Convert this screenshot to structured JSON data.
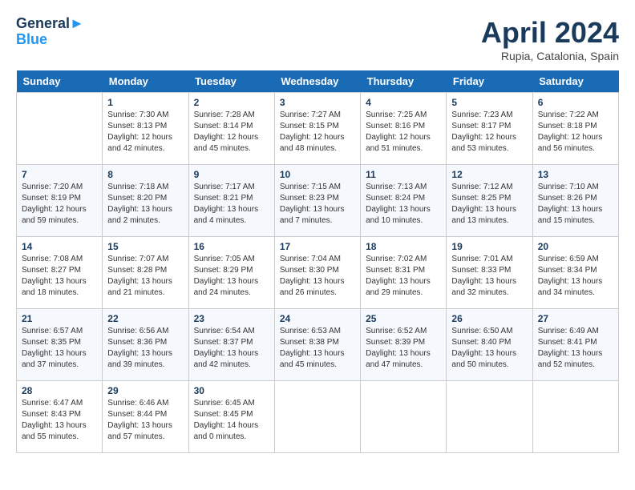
{
  "header": {
    "logo_line1": "General",
    "logo_line2": "Blue",
    "month_title": "April 2024",
    "location": "Rupia, Catalonia, Spain"
  },
  "days_of_week": [
    "Sunday",
    "Monday",
    "Tuesday",
    "Wednesday",
    "Thursday",
    "Friday",
    "Saturday"
  ],
  "weeks": [
    [
      {
        "day": "",
        "sunrise": "",
        "sunset": "",
        "daylight": ""
      },
      {
        "day": "1",
        "sunrise": "Sunrise: 7:30 AM",
        "sunset": "Sunset: 8:13 PM",
        "daylight": "Daylight: 12 hours and 42 minutes."
      },
      {
        "day": "2",
        "sunrise": "Sunrise: 7:28 AM",
        "sunset": "Sunset: 8:14 PM",
        "daylight": "Daylight: 12 hours and 45 minutes."
      },
      {
        "day": "3",
        "sunrise": "Sunrise: 7:27 AM",
        "sunset": "Sunset: 8:15 PM",
        "daylight": "Daylight: 12 hours and 48 minutes."
      },
      {
        "day": "4",
        "sunrise": "Sunrise: 7:25 AM",
        "sunset": "Sunset: 8:16 PM",
        "daylight": "Daylight: 12 hours and 51 minutes."
      },
      {
        "day": "5",
        "sunrise": "Sunrise: 7:23 AM",
        "sunset": "Sunset: 8:17 PM",
        "daylight": "Daylight: 12 hours and 53 minutes."
      },
      {
        "day": "6",
        "sunrise": "Sunrise: 7:22 AM",
        "sunset": "Sunset: 8:18 PM",
        "daylight": "Daylight: 12 hours and 56 minutes."
      }
    ],
    [
      {
        "day": "7",
        "sunrise": "Sunrise: 7:20 AM",
        "sunset": "Sunset: 8:19 PM",
        "daylight": "Daylight: 12 hours and 59 minutes."
      },
      {
        "day": "8",
        "sunrise": "Sunrise: 7:18 AM",
        "sunset": "Sunset: 8:20 PM",
        "daylight": "Daylight: 13 hours and 2 minutes."
      },
      {
        "day": "9",
        "sunrise": "Sunrise: 7:17 AM",
        "sunset": "Sunset: 8:21 PM",
        "daylight": "Daylight: 13 hours and 4 minutes."
      },
      {
        "day": "10",
        "sunrise": "Sunrise: 7:15 AM",
        "sunset": "Sunset: 8:23 PM",
        "daylight": "Daylight: 13 hours and 7 minutes."
      },
      {
        "day": "11",
        "sunrise": "Sunrise: 7:13 AM",
        "sunset": "Sunset: 8:24 PM",
        "daylight": "Daylight: 13 hours and 10 minutes."
      },
      {
        "day": "12",
        "sunrise": "Sunrise: 7:12 AM",
        "sunset": "Sunset: 8:25 PM",
        "daylight": "Daylight: 13 hours and 13 minutes."
      },
      {
        "day": "13",
        "sunrise": "Sunrise: 7:10 AM",
        "sunset": "Sunset: 8:26 PM",
        "daylight": "Daylight: 13 hours and 15 minutes."
      }
    ],
    [
      {
        "day": "14",
        "sunrise": "Sunrise: 7:08 AM",
        "sunset": "Sunset: 8:27 PM",
        "daylight": "Daylight: 13 hours and 18 minutes."
      },
      {
        "day": "15",
        "sunrise": "Sunrise: 7:07 AM",
        "sunset": "Sunset: 8:28 PM",
        "daylight": "Daylight: 13 hours and 21 minutes."
      },
      {
        "day": "16",
        "sunrise": "Sunrise: 7:05 AM",
        "sunset": "Sunset: 8:29 PM",
        "daylight": "Daylight: 13 hours and 24 minutes."
      },
      {
        "day": "17",
        "sunrise": "Sunrise: 7:04 AM",
        "sunset": "Sunset: 8:30 PM",
        "daylight": "Daylight: 13 hours and 26 minutes."
      },
      {
        "day": "18",
        "sunrise": "Sunrise: 7:02 AM",
        "sunset": "Sunset: 8:31 PM",
        "daylight": "Daylight: 13 hours and 29 minutes."
      },
      {
        "day": "19",
        "sunrise": "Sunrise: 7:01 AM",
        "sunset": "Sunset: 8:33 PM",
        "daylight": "Daylight: 13 hours and 32 minutes."
      },
      {
        "day": "20",
        "sunrise": "Sunrise: 6:59 AM",
        "sunset": "Sunset: 8:34 PM",
        "daylight": "Daylight: 13 hours and 34 minutes."
      }
    ],
    [
      {
        "day": "21",
        "sunrise": "Sunrise: 6:57 AM",
        "sunset": "Sunset: 8:35 PM",
        "daylight": "Daylight: 13 hours and 37 minutes."
      },
      {
        "day": "22",
        "sunrise": "Sunrise: 6:56 AM",
        "sunset": "Sunset: 8:36 PM",
        "daylight": "Daylight: 13 hours and 39 minutes."
      },
      {
        "day": "23",
        "sunrise": "Sunrise: 6:54 AM",
        "sunset": "Sunset: 8:37 PM",
        "daylight": "Daylight: 13 hours and 42 minutes."
      },
      {
        "day": "24",
        "sunrise": "Sunrise: 6:53 AM",
        "sunset": "Sunset: 8:38 PM",
        "daylight": "Daylight: 13 hours and 45 minutes."
      },
      {
        "day": "25",
        "sunrise": "Sunrise: 6:52 AM",
        "sunset": "Sunset: 8:39 PM",
        "daylight": "Daylight: 13 hours and 47 minutes."
      },
      {
        "day": "26",
        "sunrise": "Sunrise: 6:50 AM",
        "sunset": "Sunset: 8:40 PM",
        "daylight": "Daylight: 13 hours and 50 minutes."
      },
      {
        "day": "27",
        "sunrise": "Sunrise: 6:49 AM",
        "sunset": "Sunset: 8:41 PM",
        "daylight": "Daylight: 13 hours and 52 minutes."
      }
    ],
    [
      {
        "day": "28",
        "sunrise": "Sunrise: 6:47 AM",
        "sunset": "Sunset: 8:43 PM",
        "daylight": "Daylight: 13 hours and 55 minutes."
      },
      {
        "day": "29",
        "sunrise": "Sunrise: 6:46 AM",
        "sunset": "Sunset: 8:44 PM",
        "daylight": "Daylight: 13 hours and 57 minutes."
      },
      {
        "day": "30",
        "sunrise": "Sunrise: 6:45 AM",
        "sunset": "Sunset: 8:45 PM",
        "daylight": "Daylight: 14 hours and 0 minutes."
      },
      {
        "day": "",
        "sunrise": "",
        "sunset": "",
        "daylight": ""
      },
      {
        "day": "",
        "sunrise": "",
        "sunset": "",
        "daylight": ""
      },
      {
        "day": "",
        "sunrise": "",
        "sunset": "",
        "daylight": ""
      },
      {
        "day": "",
        "sunrise": "",
        "sunset": "",
        "daylight": ""
      }
    ]
  ]
}
